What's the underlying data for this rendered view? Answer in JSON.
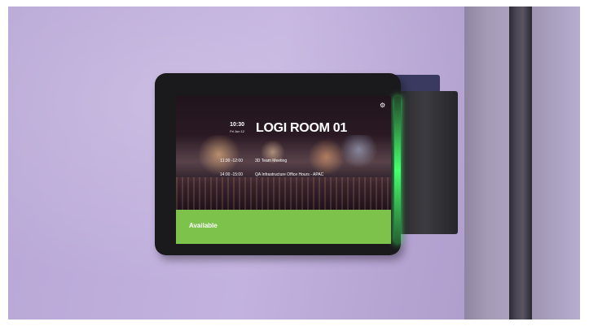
{
  "room": {
    "name": "LOGI ROOM 01",
    "clock_time": "10:30",
    "clock_date": "Fri Jun 12"
  },
  "meetings": [
    {
      "time": "11:30 -12:00",
      "title": "3D Team Meeting"
    },
    {
      "time": "14:00 -15:00",
      "title": "QA Infrastructure Office Hours - APAC"
    }
  ],
  "status": {
    "label": "Available",
    "color": "#7dc24b"
  },
  "icons": {
    "settings": "gear-icon"
  }
}
